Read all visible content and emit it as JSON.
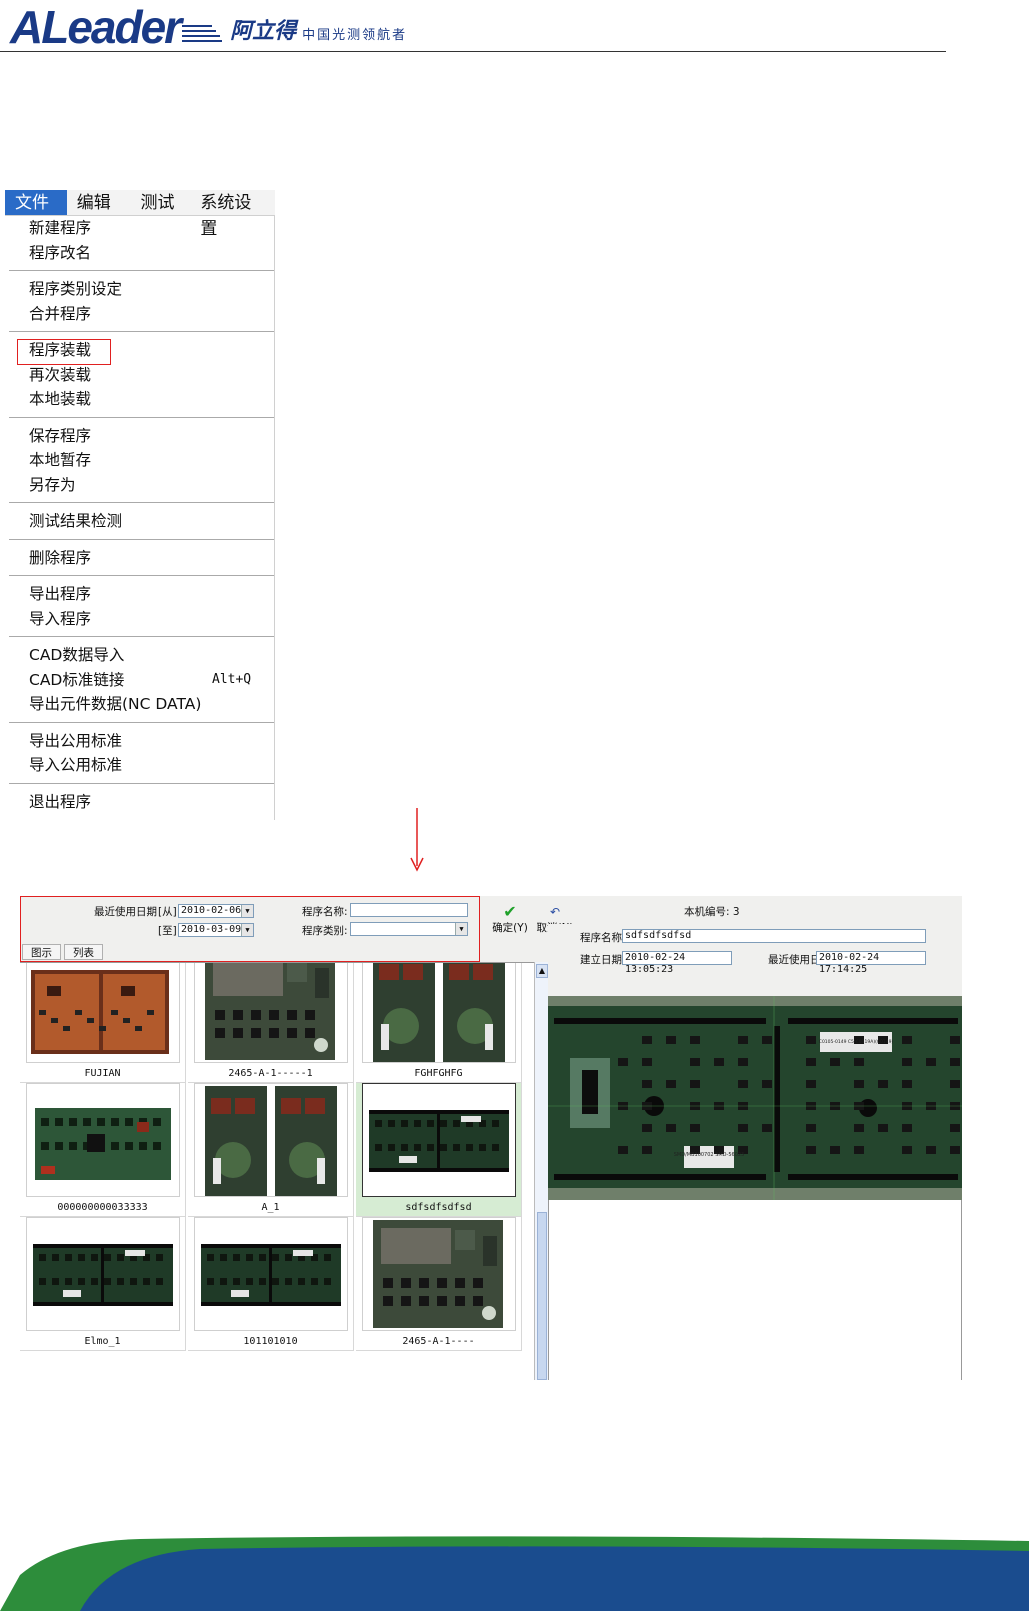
{
  "header": {
    "logo_text": "ALeader",
    "logo_cn": "阿立得",
    "tagline": "中国光测领航者"
  },
  "menu": {
    "top": [
      "文件",
      "编辑",
      "测试",
      "系统设置"
    ],
    "groups": [
      [
        {
          "label": "新建程序"
        },
        {
          "label": "程序改名"
        }
      ],
      [
        {
          "label": "程序类别设定"
        },
        {
          "label": "合并程序"
        }
      ],
      [
        {
          "label": "程序装载",
          "highlighted": true
        },
        {
          "label": "再次装载"
        },
        {
          "label": "本地装载"
        }
      ],
      [
        {
          "label": "保存程序"
        },
        {
          "label": "本地暂存"
        },
        {
          "label": "另存为"
        }
      ],
      [
        {
          "label": "测试结果检测"
        }
      ],
      [
        {
          "label": "删除程序"
        }
      ],
      [
        {
          "label": "导出程序"
        },
        {
          "label": "导入程序"
        }
      ],
      [
        {
          "label": "CAD数据导入"
        },
        {
          "label": "CAD标准链接",
          "shortcut": "Alt+Q"
        },
        {
          "label": "导出元件数据(NC DATA)"
        }
      ],
      [
        {
          "label": "导出公用标准"
        },
        {
          "label": "导入公用标准"
        }
      ],
      [
        {
          "label": "退出程序"
        }
      ]
    ]
  },
  "dialog": {
    "recent_date_label": "最近使用日期",
    "from_label": "[从]",
    "to_label": "[至]",
    "date_from": "2010-02-06",
    "date_to": "2010-03-09",
    "program_name_label": "程序名称:",
    "program_name_value": "",
    "program_type_label": "程序类别:",
    "program_type_value": "",
    "ok_label": "确定(Y)",
    "cancel_label": "取消(N)",
    "machine_no_label": "本机编号: 3",
    "tabs": [
      "图示",
      "列表"
    ],
    "thumbnails": [
      {
        "name": "FUJIAN",
        "style": "orange"
      },
      {
        "name": "2465-A-1-----1",
        "style": "tall"
      },
      {
        "name": "FGHFGHFG",
        "style": "circles"
      },
      {
        "name": "000000000033333",
        "style": "green"
      },
      {
        "name": "A_1",
        "style": "circles"
      },
      {
        "name": "sdfsdfsdfsd",
        "style": "dark",
        "selected": true
      },
      {
        "name": "Elmo_1",
        "style": "dark"
      },
      {
        "name": "101101010",
        "style": "dark"
      },
      {
        "name": "2465-A-1----",
        "style": "tall"
      }
    ],
    "detail": {
      "name_label": "程序名称",
      "name_value": "sdfsdfsdfsd",
      "created_label": "建立日期",
      "created_value": "2010-02-24 13:05:23",
      "last_used_label": "最近使用日",
      "last_used_value": "2010-02-24 17:14:25",
      "board_labels": [
        "C0105-0149 C5(C0119A)(C0149)",
        "SMD/MB100702 SMD-56023"
      ]
    }
  },
  "colors": {
    "brand": "#1a3a86",
    "highlight": "#e02020",
    "menu_active": "#2a6bc7",
    "pcb_green": "#1f4a2c"
  }
}
